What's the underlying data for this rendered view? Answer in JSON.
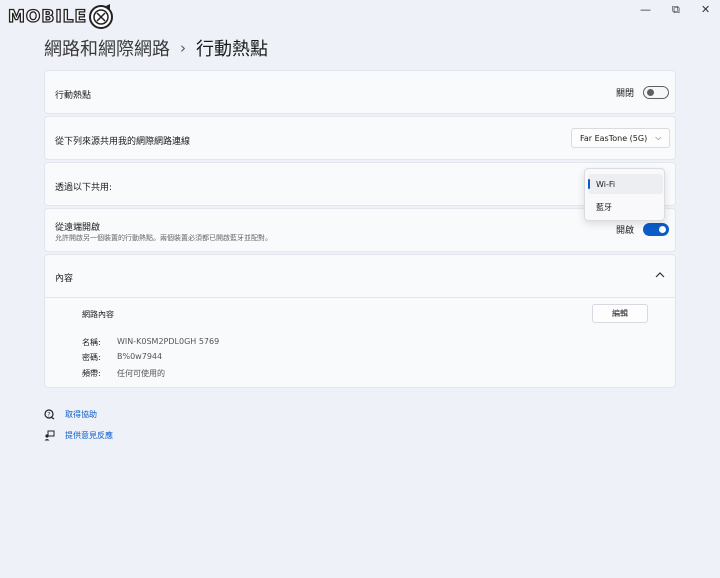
{
  "logo": {
    "text": "MOBILE"
  },
  "window_controls": {
    "minimize": "—",
    "maximize": "⧉",
    "close": "✕"
  },
  "breadcrumb": {
    "parent": "網路和網際網路",
    "separator": "›",
    "current": "行動熱點"
  },
  "hotspot": {
    "label": "行動熱點",
    "state_text": "關閉",
    "on": false
  },
  "share_from": {
    "label": "從下列來源共用我的網際網路連線",
    "value": "Far EasTone (5G)"
  },
  "share_over": {
    "label": "透過以下共用:",
    "options": [
      "Wi-Fi",
      "藍牙"
    ],
    "selected": "Wi-Fi"
  },
  "remote": {
    "label": "從遠端開啟",
    "sublabel": "允許開啟另一個裝置的行動熱點。兩個裝置必須都已開啟藍牙並配對。",
    "state_text": "開啟",
    "on": true
  },
  "properties": {
    "header": "內容",
    "network_props_label": "網路內容",
    "edit_button": "編輯",
    "name_key": "名稱:",
    "name_value": "WIN-K0SM2PDL0GH 5769",
    "password_key": "密碼:",
    "password_value": "B%0w7944",
    "band_key": "頻帶:",
    "band_value": "任何可使用的"
  },
  "links": {
    "help": "取得協助",
    "feedback": "提供意見反應"
  },
  "colors": {
    "accent": "#0b5cc9",
    "background": "#eef1f7",
    "card": "#f9fafc"
  }
}
